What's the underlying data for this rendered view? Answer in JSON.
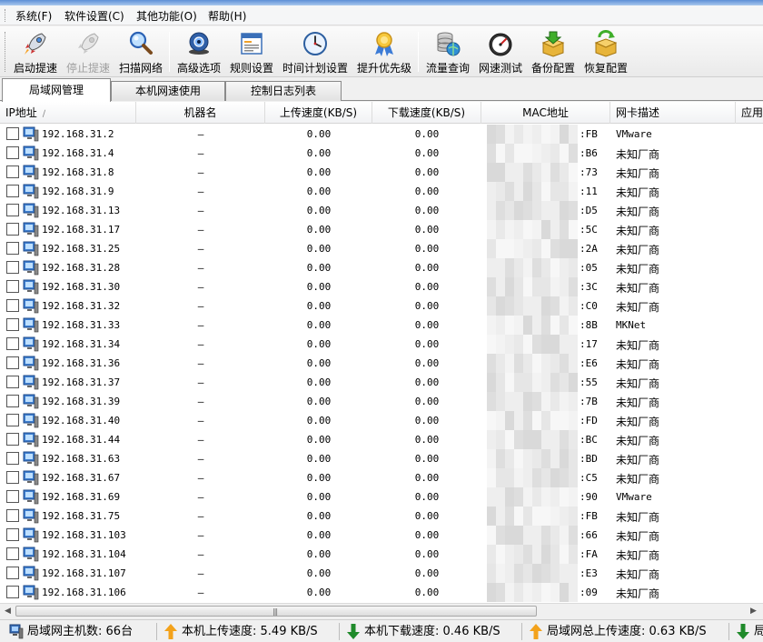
{
  "menubar": {
    "items": [
      {
        "label": "系统(F)"
      },
      {
        "label": "软件设置(C)"
      },
      {
        "label": "其他功能(O)"
      },
      {
        "label": "帮助(H)"
      }
    ]
  },
  "toolbar": {
    "buttons": [
      {
        "label": "启动提速",
        "icon": "rocket-icon",
        "disabled": false
      },
      {
        "label": "停止提速",
        "icon": "rocket-disabled-icon",
        "disabled": true
      },
      {
        "label": "扫描网络",
        "icon": "magnifier-icon",
        "disabled": false
      },
      {
        "label": "高级选项",
        "icon": "webcam-globe-icon",
        "disabled": false
      },
      {
        "label": "规则设置",
        "icon": "document-window-icon",
        "disabled": false
      },
      {
        "label": "时间计划设置",
        "icon": "clock-icon",
        "disabled": false
      },
      {
        "label": "提升优先级",
        "icon": "medal-icon",
        "disabled": false
      },
      {
        "label": "流量查询",
        "icon": "database-globe-icon",
        "disabled": false
      },
      {
        "label": "网速测试",
        "icon": "speedometer-icon",
        "disabled": false
      },
      {
        "label": "备份配置",
        "icon": "box-download-icon",
        "disabled": false
      },
      {
        "label": "恢复配置",
        "icon": "box-refresh-icon",
        "disabled": false
      }
    ]
  },
  "tabs": [
    {
      "label": "局域网管理",
      "active": true
    },
    {
      "label": "本机网速使用",
      "active": false
    },
    {
      "label": "控制日志列表",
      "active": false
    }
  ],
  "table": {
    "columns": {
      "ip": "IP地址",
      "name": "机器名",
      "up": "上传速度(KB/S)",
      "down": "下载速度(KB/S)",
      "mac": "MAC地址",
      "desc": "网卡描述",
      "app": "应用"
    },
    "rows": [
      {
        "ip": "192.168.31.2",
        "name": "—",
        "up": "0.00",
        "down": "0.00",
        "mac": ":FB",
        "desc": "VMware"
      },
      {
        "ip": "192.168.31.4",
        "name": "—",
        "up": "0.00",
        "down": "0.00",
        "mac": ":B6",
        "desc": "未知厂商"
      },
      {
        "ip": "192.168.31.8",
        "name": "—",
        "up": "0.00",
        "down": "0.00",
        "mac": ":73",
        "desc": "未知厂商"
      },
      {
        "ip": "192.168.31.9",
        "name": "—",
        "up": "0.00",
        "down": "0.00",
        "mac": ":11",
        "desc": "未知厂商"
      },
      {
        "ip": "192.168.31.13",
        "name": "—",
        "up": "0.00",
        "down": "0.00",
        "mac": ":D5",
        "desc": "未知厂商"
      },
      {
        "ip": "192.168.31.17",
        "name": "—",
        "up": "0.00",
        "down": "0.00",
        "mac": ":5C",
        "desc": "未知厂商"
      },
      {
        "ip": "192.168.31.25",
        "name": "—",
        "up": "0.00",
        "down": "0.00",
        "mac": ":2A",
        "desc": "未知厂商"
      },
      {
        "ip": "192.168.31.28",
        "name": "—",
        "up": "0.00",
        "down": "0.00",
        "mac": ":05",
        "desc": "未知厂商"
      },
      {
        "ip": "192.168.31.30",
        "name": "—",
        "up": "0.00",
        "down": "0.00",
        "mac": ":3C",
        "desc": "未知厂商"
      },
      {
        "ip": "192.168.31.32",
        "name": "—",
        "up": "0.00",
        "down": "0.00",
        "mac": ":C0",
        "desc": "未知厂商"
      },
      {
        "ip": "192.168.31.33",
        "name": "—",
        "up": "0.00",
        "down": "0.00",
        "mac": ":8B",
        "desc": "MKNet"
      },
      {
        "ip": "192.168.31.34",
        "name": "—",
        "up": "0.00",
        "down": "0.00",
        "mac": ":17",
        "desc": "未知厂商"
      },
      {
        "ip": "192.168.31.36",
        "name": "—",
        "up": "0.00",
        "down": "0.00",
        "mac": ":E6",
        "desc": "未知厂商"
      },
      {
        "ip": "192.168.31.37",
        "name": "—",
        "up": "0.00",
        "down": "0.00",
        "mac": ":55",
        "desc": "未知厂商"
      },
      {
        "ip": "192.168.31.39",
        "name": "—",
        "up": "0.00",
        "down": "0.00",
        "mac": ":7B",
        "desc": "未知厂商"
      },
      {
        "ip": "192.168.31.40",
        "name": "—",
        "up": "0.00",
        "down": "0.00",
        "mac": ":FD",
        "desc": "未知厂商"
      },
      {
        "ip": "192.168.31.44",
        "name": "—",
        "up": "0.00",
        "down": "0.00",
        "mac": ":BC",
        "desc": "未知厂商"
      },
      {
        "ip": "192.168.31.63",
        "name": "—",
        "up": "0.00",
        "down": "0.00",
        "mac": ":BD",
        "desc": "未知厂商"
      },
      {
        "ip": "192.168.31.67",
        "name": "—",
        "up": "0.00",
        "down": "0.00",
        "mac": ":C5",
        "desc": "未知厂商"
      },
      {
        "ip": "192.168.31.69",
        "name": "—",
        "up": "0.00",
        "down": "0.00",
        "mac": ":90",
        "desc": "VMware"
      },
      {
        "ip": "192.168.31.75",
        "name": "—",
        "up": "0.00",
        "down": "0.00",
        "mac": ":FB",
        "desc": "未知厂商"
      },
      {
        "ip": "192.168.31.103",
        "name": "—",
        "up": "0.00",
        "down": "0.00",
        "mac": ":66",
        "desc": "未知厂商"
      },
      {
        "ip": "192.168.31.104",
        "name": "—",
        "up": "0.00",
        "down": "0.00",
        "mac": ":FA",
        "desc": "未知厂商"
      },
      {
        "ip": "192.168.31.107",
        "name": "—",
        "up": "0.00",
        "down": "0.00",
        "mac": ":E3",
        "desc": "未知厂商"
      },
      {
        "ip": "192.168.31.106",
        "name": "—",
        "up": "0.00",
        "down": "0.00",
        "mac": ":09",
        "desc": "未知厂商"
      }
    ]
  },
  "status": {
    "hosts_label": "局域网主机数:",
    "hosts_value": "66台",
    "local_up_label": "本机上传速度:",
    "local_up_value": "5.49 KB/S",
    "local_down_label": "本机下载速度:",
    "local_down_value": "0.46 KB/S",
    "lan_up_label": "局域网总上传速度:",
    "lan_up_value": "0.63 KB/S",
    "lan_down_label": "局"
  },
  "colors": {
    "up_arrow": "#f3a21b",
    "down_arrow": "#1f8a2a",
    "header_bg": "#f1f2f4",
    "tab_border": "#8a8a8a"
  }
}
